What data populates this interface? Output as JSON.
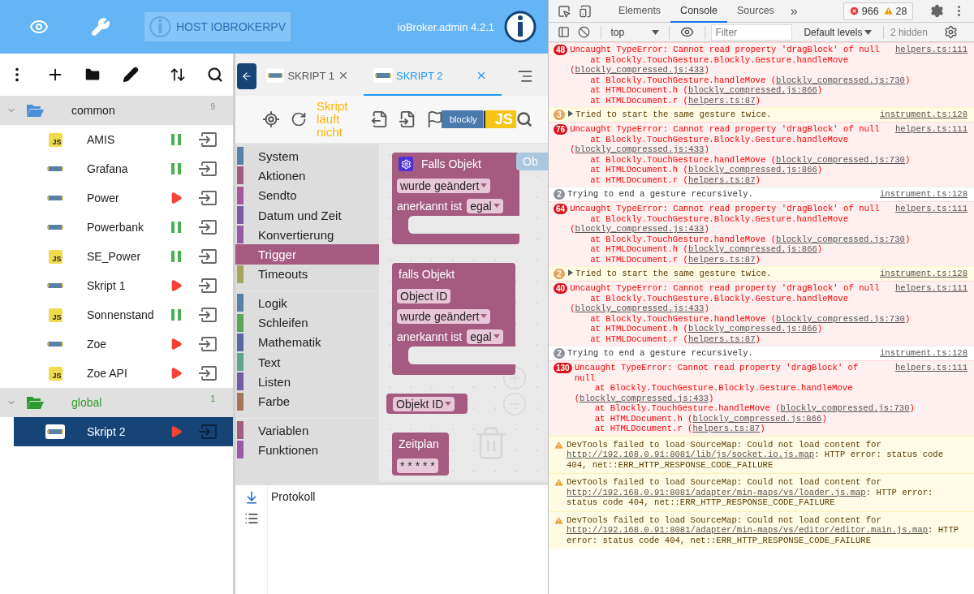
{
  "header": {
    "host": "HOST IOBROKERPV",
    "version": "ioBroker.admin 4.2.1"
  },
  "tree": [
    {
      "name": "common",
      "count": "9",
      "expanded": true,
      "selected": false,
      "color": "#4a90d9",
      "children": [
        {
          "name": "AMIS",
          "kind": "js",
          "icon_label": "JS",
          "running": true,
          "selected": false
        },
        {
          "name": "Grafana",
          "kind": "blockly",
          "running": true,
          "selected": false
        },
        {
          "name": "Power",
          "kind": "blockly",
          "running": false,
          "selected": false
        },
        {
          "name": "Powerbank",
          "kind": "blockly",
          "running": true,
          "selected": false
        },
        {
          "name": "SE_Power",
          "kind": "js",
          "icon_label": "JS",
          "running": true,
          "selected": false
        },
        {
          "name": "Skript 1",
          "kind": "blockly",
          "running": false,
          "selected": false
        },
        {
          "name": "Sonnenstand",
          "kind": "js",
          "icon_label": "JS",
          "running": true,
          "selected": false
        },
        {
          "name": "Zoe",
          "kind": "blockly",
          "running": false,
          "selected": false
        },
        {
          "name": "Zoe API",
          "kind": "js",
          "icon_label": "JS",
          "running": false,
          "selected": false
        }
      ]
    },
    {
      "name": "global",
      "count": "1",
      "expanded": true,
      "selected": false,
      "color": "#2e9b2e",
      "children": [
        {
          "name": "Skript 2",
          "kind": "blockly",
          "running": false,
          "selected": true
        }
      ]
    }
  ],
  "editor": {
    "tabs": [
      {
        "label": "SKRIPT 1",
        "selected": false
      },
      {
        "label": "SKRIPT 2",
        "selected": true
      }
    ],
    "status": "Skript läuft nicht",
    "mode_toggle": {
      "left": "blockly",
      "right": "JS"
    },
    "toolbox": [
      [
        {
          "label": "System",
          "color": "#5b80a5",
          "selected": false
        },
        {
          "label": "Aktionen",
          "color": "#a55b80",
          "selected": false
        },
        {
          "label": "Sendto",
          "color": "#a5589a",
          "selected": false
        },
        {
          "label": "Datum und Zeit",
          "color": "#7b5ba5",
          "selected": false
        },
        {
          "label": "Konvertierung",
          "color": "#935ba5",
          "selected": false
        },
        {
          "label": "Trigger",
          "color": "#a55b80",
          "selected": true
        },
        {
          "label": "Timeouts",
          "color": "#a5a55b",
          "selected": false
        }
      ],
      [
        {
          "label": "Logik",
          "color": "#5b80a5",
          "selected": false
        },
        {
          "label": "Schleifen",
          "color": "#5ba55b",
          "selected": false
        },
        {
          "label": "Mathematik",
          "color": "#5b67a5",
          "selected": false
        },
        {
          "label": "Text",
          "color": "#5ba58c",
          "selected": false
        },
        {
          "label": "Listen",
          "color": "#745ba5",
          "selected": false
        },
        {
          "label": "Farbe",
          "color": "#a5745b",
          "selected": false
        }
      ],
      [
        {
          "label": "Variablen",
          "color": "#a55b80",
          "selected": false
        },
        {
          "label": "Funktionen",
          "color": "#995ba5",
          "selected": false
        }
      ]
    ],
    "blocks": [
      {
        "kind": "event",
        "color": "#a55b80",
        "title": "Falls Objekt",
        "mutator": true,
        "statement": true,
        "rows": [
          [
            {
              "kind": "dropdown",
              "text": "wurde geändert"
            }
          ],
          [
            {
              "kind": "label",
              "text": "anerkannt ist"
            },
            {
              "kind": "dropdown",
              "text": "egal"
            }
          ]
        ]
      },
      {
        "kind": "event",
        "color": "#a55b80",
        "title": "falls Objekt",
        "mutator": false,
        "statement": true,
        "rows": [
          [
            {
              "kind": "field",
              "text": "Object ID"
            }
          ],
          [
            {
              "kind": "dropdown",
              "text": "wurde geändert"
            }
          ],
          [
            {
              "kind": "label",
              "text": "anerkannt ist"
            },
            {
              "kind": "dropdown",
              "text": "egal"
            }
          ]
        ]
      },
      {
        "kind": "value",
        "color": "#a55b80",
        "rows": [
          [
            {
              "kind": "dropdown",
              "text": "Objekt ID"
            }
          ]
        ]
      },
      {
        "kind": "event",
        "color": "#a55b80",
        "title": "Zeitplan",
        "mutator": false,
        "statement": false,
        "rows": [
          [
            {
              "kind": "field",
              "text": "* * * * *"
            }
          ]
        ]
      },
      {
        "kind": "value",
        "color": "#a9c8e0",
        "title": "Ob"
      }
    ],
    "log": {
      "title": "Protokoll"
    }
  },
  "devtools": {
    "tabs": [
      {
        "label": "Elements",
        "selected": false
      },
      {
        "label": "Console",
        "selected": true
      },
      {
        "label": "Sources",
        "selected": false
      }
    ],
    "more": "»",
    "error_count": "966",
    "warning_count": "28",
    "context": "top",
    "filter": {
      "placeholder": "Filter"
    },
    "levels": "Default levels",
    "hidden": "2 hidden",
    "messages": [
      {
        "kind": "error",
        "count": "48",
        "text": "Uncaught TypeError: Cannot read property 'dragBlock' of null",
        "source": "helpers.ts:111",
        "stack": [
          {
            "prefix": "at Blockly.TouchGesture.Blockly.Gesture.handleMove (",
            "link": "blockly_compressed.js:433",
            "suffix": ")"
          },
          {
            "prefix": "at Blockly.TouchGesture.handleMove (",
            "link": "blockly_compressed.js:730",
            "suffix": ")"
          },
          {
            "prefix": "at HTMLDocument.h (",
            "link": "blockly_compressed.js:866",
            "suffix": ")"
          },
          {
            "prefix": "at HTMLDocument.r (",
            "link": "helpers.ts:87",
            "suffix": ")"
          }
        ]
      },
      {
        "kind": "group",
        "count": "3",
        "expanded": false,
        "text": "Tried to start the same gesture twice.",
        "source": "instrument.ts:128"
      },
      {
        "kind": "error",
        "count": "76",
        "text": "Uncaught TypeError: Cannot read property 'dragBlock' of null",
        "source": "helpers.ts:111",
        "stack": [
          {
            "prefix": "at Blockly.TouchGesture.Blockly.Gesture.handleMove (",
            "link": "blockly_compressed.js:433",
            "suffix": ")"
          },
          {
            "prefix": "at Blockly.TouchGesture.handleMove (",
            "link": "blockly_compressed.js:730",
            "suffix": ")"
          },
          {
            "prefix": "at HTMLDocument.h (",
            "link": "blockly_compressed.js:866",
            "suffix": ")"
          },
          {
            "prefix": "at HTMLDocument.r (",
            "link": "helpers.ts:87",
            "suffix": ")"
          }
        ]
      },
      {
        "kind": "info",
        "count": "2",
        "text": "Trying to end a gesture recursively.",
        "source": "instrument.ts:128"
      },
      {
        "kind": "error",
        "count": "64",
        "text": "Uncaught TypeError: Cannot read property 'dragBlock' of null",
        "source": "helpers.ts:111",
        "stack": [
          {
            "prefix": "at Blockly.TouchGesture.Blockly.Gesture.handleMove (",
            "link": "blockly_compressed.js:433",
            "suffix": ")"
          },
          {
            "prefix": "at Blockly.TouchGesture.handleMove (",
            "link": "blockly_compressed.js:730",
            "suffix": ")"
          },
          {
            "prefix": "at HTMLDocument.h (",
            "link": "blockly_compressed.js:866",
            "suffix": ")"
          },
          {
            "prefix": "at HTMLDocument.r (",
            "link": "helpers.ts:87",
            "suffix": ")"
          }
        ]
      },
      {
        "kind": "group",
        "count": "2",
        "expanded": false,
        "text": "Tried to start the same gesture twice.",
        "source": "instrument.ts:128"
      },
      {
        "kind": "error",
        "count": "40",
        "text": "Uncaught TypeError: Cannot read property 'dragBlock' of null",
        "source": "helpers.ts:111",
        "stack": [
          {
            "prefix": "at Blockly.TouchGesture.Blockly.Gesture.handleMove (",
            "link": "blockly_compressed.js:433",
            "suffix": ")"
          },
          {
            "prefix": "at Blockly.TouchGesture.handleMove (",
            "link": "blockly_compressed.js:730",
            "suffix": ")"
          },
          {
            "prefix": "at HTMLDocument.h (",
            "link": "blockly_compressed.js:866",
            "suffix": ")"
          },
          {
            "prefix": "at HTMLDocument.r (",
            "link": "helpers.ts:87",
            "suffix": ")"
          }
        ]
      },
      {
        "kind": "info",
        "count": "2",
        "text": "Trying to end a gesture recursively.",
        "source": "instrument.ts:128"
      },
      {
        "kind": "error",
        "count": "130",
        "text": "Uncaught TypeError: Cannot read property 'dragBlock' of null",
        "source": "helpers.ts:111",
        "stack": [
          {
            "prefix": "at Blockly.TouchGesture.Blockly.Gesture.handleMove (",
            "link": "blockly_compressed.js:433",
            "suffix": ")"
          },
          {
            "prefix": "at Blockly.TouchGesture.handleMove (",
            "link": "blockly_compressed.js:730",
            "suffix": ")"
          },
          {
            "prefix": "at HTMLDocument.h (",
            "link": "blockly_compressed.js:866",
            "suffix": ")"
          },
          {
            "prefix": "at HTMLDocument.r (",
            "link": "helpers.ts:87",
            "suffix": ")"
          }
        ]
      },
      {
        "kind": "warning",
        "text": "DevTools failed to load SourceMap: Could not load content for ",
        "link": "http://192.168.0.91:8081/lib/js/socket.io.js.map",
        "suffix": ": HTTP error: status code 404, net::ERR_HTTP_RESPONSE_CODE_FAILURE"
      },
      {
        "kind": "warning",
        "text": "DevTools failed to load SourceMap: Could not load content for ",
        "link": "http://192.168.0.91:8081/adapter/min-maps/vs/loader.js.map",
        "suffix": ": HTTP error: status code 404, net::ERR_HTTP_RESPONSE_CODE_FAILURE"
      },
      {
        "kind": "warning",
        "text": "DevTools failed to load SourceMap: Could not load content for ",
        "link": "http://192.168.0.91:8081/adapter/min-maps/vs/editor/editor.main.js.map",
        "suffix": ": HTTP error: status code 404, net::ERR_HTTP_RESPONSE_CODE_FAILURE"
      }
    ]
  }
}
